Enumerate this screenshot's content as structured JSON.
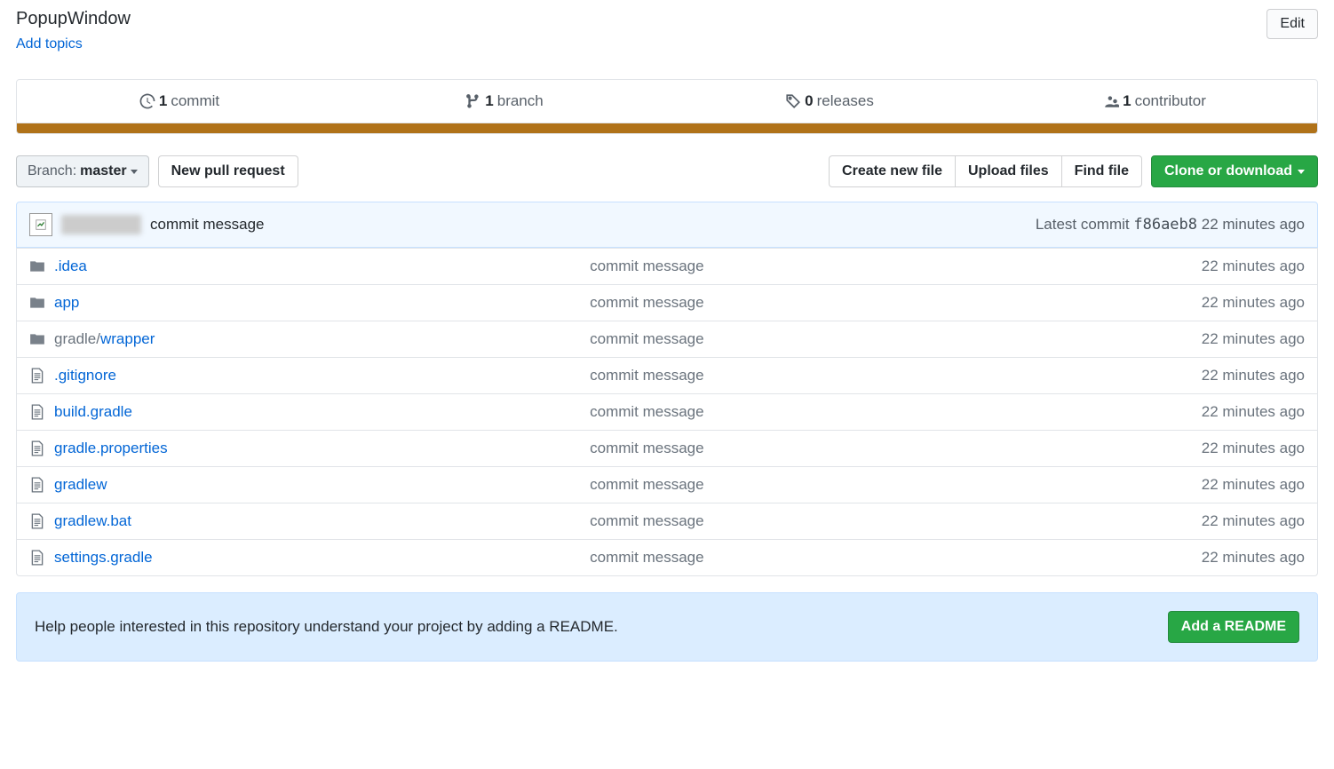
{
  "header": {
    "description": "PopupWindow",
    "add_topics": "Add topics",
    "edit": "Edit"
  },
  "stats": {
    "commits_count": "1",
    "commits_label": "commit",
    "branches_count": "1",
    "branches_label": "branch",
    "releases_count": "0",
    "releases_label": "releases",
    "contributors_count": "1",
    "contributors_label": "contributor"
  },
  "language_bar_color": "#b07219",
  "actions": {
    "branch_prefix": "Branch:",
    "branch_value": "master",
    "new_pull_request": "New pull request",
    "create_new_file": "Create new file",
    "upload_files": "Upload files",
    "find_file": "Find file",
    "clone": "Clone or download"
  },
  "latest_commit": {
    "message": "commit message",
    "prefix": "Latest commit",
    "sha": "f86aeb8",
    "time": "22 minutes ago"
  },
  "files": [
    {
      "type": "folder",
      "name": ".idea",
      "prefix": "",
      "msg": "commit message",
      "time": "22 minutes ago"
    },
    {
      "type": "folder",
      "name": "app",
      "prefix": "",
      "msg": "commit message",
      "time": "22 minutes ago"
    },
    {
      "type": "folder",
      "name": "wrapper",
      "prefix": "gradle/",
      "msg": "commit message",
      "time": "22 minutes ago"
    },
    {
      "type": "file",
      "name": ".gitignore",
      "prefix": "",
      "msg": "commit message",
      "time": "22 minutes ago"
    },
    {
      "type": "file",
      "name": "build.gradle",
      "prefix": "",
      "msg": "commit message",
      "time": "22 minutes ago"
    },
    {
      "type": "file",
      "name": "gradle.properties",
      "prefix": "",
      "msg": "commit message",
      "time": "22 minutes ago"
    },
    {
      "type": "file",
      "name": "gradlew",
      "prefix": "",
      "msg": "commit message",
      "time": "22 minutes ago"
    },
    {
      "type": "file",
      "name": "gradlew.bat",
      "prefix": "",
      "msg": "commit message",
      "time": "22 minutes ago"
    },
    {
      "type": "file",
      "name": "settings.gradle",
      "prefix": "",
      "msg": "commit message",
      "time": "22 minutes ago"
    }
  ],
  "readme_banner": {
    "text": "Help people interested in this repository understand your project by adding a README.",
    "button": "Add a README"
  }
}
